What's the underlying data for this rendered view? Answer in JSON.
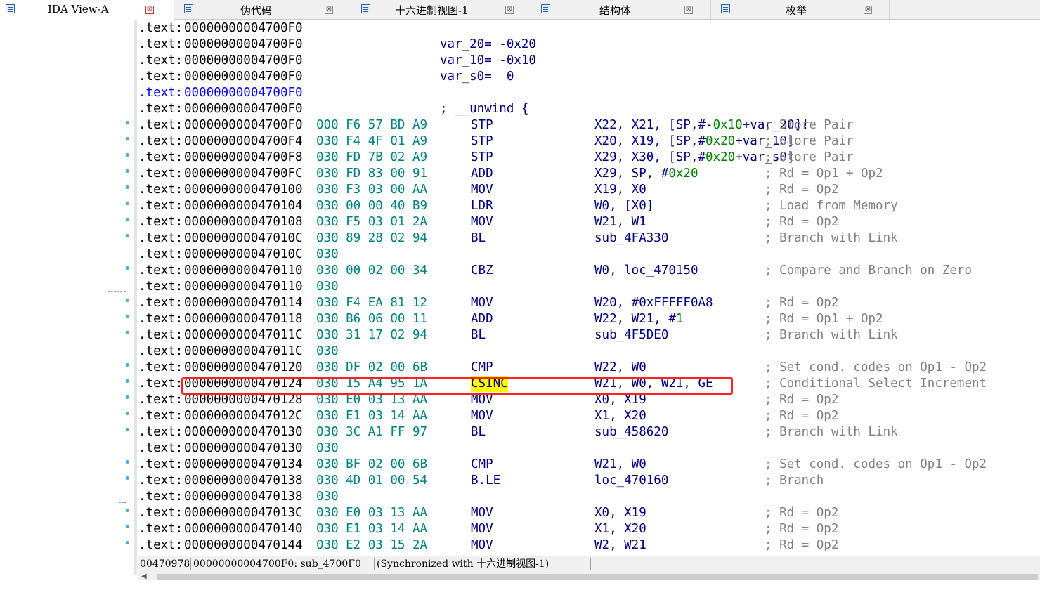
{
  "tabs": [
    {
      "label": "IDA View-A",
      "close": "⊠",
      "icon": "listing-icon",
      "active": true
    },
    {
      "label": "伪代码",
      "close": "⊠",
      "icon": "pseudocode-icon",
      "active": false
    },
    {
      "label": "十六进制视图-1",
      "close": "⊠",
      "icon": "hex-view-icon",
      "active": false
    },
    {
      "label": "结构体",
      "close": "⊠",
      "icon": "structures-icon",
      "active": false
    },
    {
      "label": "枚举",
      "close": "⊠",
      "icon": "enums-icon",
      "active": false
    }
  ],
  "listing": [
    {
      "seg": ".text:",
      "addr": "00000000004700F0",
      "bytes": "",
      "mn": "",
      "ops": [],
      "comment": "",
      "label": ""
    },
    {
      "seg": ".text:",
      "addr": "00000000004700F0",
      "bytes": "",
      "mn": "",
      "ops": [],
      "comment": "",
      "label": "var_20= -0x20"
    },
    {
      "seg": ".text:",
      "addr": "00000000004700F0",
      "bytes": "",
      "mn": "",
      "ops": [],
      "comment": "",
      "label": "var_10= -0x10"
    },
    {
      "seg": ".text:",
      "addr": "00000000004700F0",
      "bytes": "",
      "mn": "",
      "ops": [],
      "comment": "",
      "label": "var_s0=  0"
    },
    {
      "seg": ".text:",
      "addr": "00000000004700F0",
      "bytes": "",
      "mn": "",
      "ops": [],
      "comment": "",
      "label": "",
      "blue": true
    },
    {
      "seg": ".text:",
      "addr": "00000000004700F0",
      "bytes": "",
      "mn": "",
      "ops": [],
      "comment": "",
      "label": "; __unwind {"
    },
    {
      "seg": ".text:",
      "addr": "00000000004700F0",
      "bytes": "000 F6 57 BD A9",
      "mn": "STP",
      "ops": [
        "X22, X21, [SP,#-",
        "0x10",
        "+",
        "var_20",
        "]!"
      ],
      "comment": "; Store Pair"
    },
    {
      "seg": ".text:",
      "addr": "00000000004700F4",
      "bytes": "030 F4 4F 01 A9",
      "mn": "STP",
      "ops": [
        "X20, X19, [SP,#",
        "0x20",
        "+",
        "var_10",
        "]"
      ],
      "comment": "; Store Pair"
    },
    {
      "seg": ".text:",
      "addr": "00000000004700F8",
      "bytes": "030 FD 7B 02 A9",
      "mn": "STP",
      "ops": [
        "X29, X30, [SP,#",
        "0x20",
        "+",
        "var_s0",
        "]"
      ],
      "comment": "; Store Pair"
    },
    {
      "seg": ".text:",
      "addr": "00000000004700FC",
      "bytes": "030 FD 83 00 91",
      "mn": "ADD",
      "ops": [
        "X29, SP, #",
        "0x20"
      ],
      "comment": "; Rd = Op1 + Op2"
    },
    {
      "seg": ".text:",
      "addr": "0000000000470100",
      "bytes": "030 F3 03 00 AA",
      "mn": "MOV",
      "ops": [
        "X19, X0"
      ],
      "comment": "; Rd = Op2"
    },
    {
      "seg": ".text:",
      "addr": "0000000000470104",
      "bytes": "030 00 00 40 B9",
      "mn": "LDR",
      "ops": [
        "W0, [X0]"
      ],
      "comment": "; Load from Memory"
    },
    {
      "seg": ".text:",
      "addr": "0000000000470108",
      "bytes": "030 F5 03 01 2A",
      "mn": "MOV",
      "ops": [
        "W21, W1"
      ],
      "comment": "; Rd = Op2"
    },
    {
      "seg": ".text:",
      "addr": "000000000047010C",
      "bytes": "030 89 28 02 94",
      "mn": "BL",
      "ops": [
        "sub_4FA330"
      ],
      "comment": "; Branch with Link"
    },
    {
      "seg": ".text:",
      "addr": "000000000047010C",
      "bytes": "030",
      "mn": "",
      "ops": [],
      "comment": ""
    },
    {
      "seg": ".text:",
      "addr": "0000000000470110",
      "bytes": "030 00 02 00 34",
      "mn": "CBZ",
      "ops": [
        "W0, loc_470150"
      ],
      "comment": "; Compare and Branch on Zero"
    },
    {
      "seg": ".text:",
      "addr": "0000000000470110",
      "bytes": "030",
      "mn": "",
      "ops": [],
      "comment": ""
    },
    {
      "seg": ".text:",
      "addr": "0000000000470114",
      "bytes": "030 F4 EA 81 12",
      "mn": "MOV",
      "ops": [
        "W20, #0xFFFFF0A8"
      ],
      "comment": "; Rd = Op2"
    },
    {
      "seg": ".text:",
      "addr": "0000000000470118",
      "bytes": "030 B6 06 00 11",
      "mn": "ADD",
      "ops": [
        "W22, W21, #",
        "1"
      ],
      "comment": "; Rd = Op1 + Op2"
    },
    {
      "seg": ".text:",
      "addr": "000000000047011C",
      "bytes": "030 31 17 02 94",
      "mn": "BL",
      "ops": [
        "sub_4F5DE0"
      ],
      "comment": "; Branch with Link"
    },
    {
      "seg": ".text:",
      "addr": "000000000047011C",
      "bytes": "030",
      "mn": "",
      "ops": [],
      "comment": ""
    },
    {
      "seg": ".text:",
      "addr": "0000000000470120",
      "bytes": "030 DF 02 00 6B",
      "mn": "CMP",
      "ops": [
        "W22, W0"
      ],
      "comment": "; Set cond. codes on Op1 - Op2"
    },
    {
      "seg": ".text:",
      "addr": "0000000000470124",
      "bytes": "030 15 A4 95 1A",
      "mn": "CSINC",
      "ops": [
        "W21, W0, W21, GE"
      ],
      "comment": "; Conditional Select Increment",
      "highlight": true
    },
    {
      "seg": ".text:",
      "addr": "0000000000470128",
      "bytes": "030 E0 03 13 AA",
      "mn": "MOV",
      "ops": [
        "X0, X19"
      ],
      "comment": "; Rd = Op2"
    },
    {
      "seg": ".text:",
      "addr": "000000000047012C",
      "bytes": "030 E1 03 14 AA",
      "mn": "MOV",
      "ops": [
        "X1, X20"
      ],
      "comment": "; Rd = Op2"
    },
    {
      "seg": ".text:",
      "addr": "0000000000470130",
      "bytes": "030 3C A1 FF 97",
      "mn": "BL",
      "ops": [
        "sub_458620"
      ],
      "comment": "; Branch with Link"
    },
    {
      "seg": ".text:",
      "addr": "0000000000470130",
      "bytes": "030",
      "mn": "",
      "ops": [],
      "comment": ""
    },
    {
      "seg": ".text:",
      "addr": "0000000000470134",
      "bytes": "030 BF 02 00 6B",
      "mn": "CMP",
      "ops": [
        "W21, W0"
      ],
      "comment": "; Set cond. codes on Op1 - Op2"
    },
    {
      "seg": ".text:",
      "addr": "0000000000470138",
      "bytes": "030 4D 01 00 54",
      "mn": "B.LE",
      "ops": [
        "loc_470160"
      ],
      "comment": "; Branch"
    },
    {
      "seg": ".text:",
      "addr": "0000000000470138",
      "bytes": "030",
      "mn": "",
      "ops": [],
      "comment": ""
    },
    {
      "seg": ".text:",
      "addr": "000000000047013C",
      "bytes": "030 E0 03 13 AA",
      "mn": "MOV",
      "ops": [
        "X0, X19"
      ],
      "comment": "; Rd = Op2"
    },
    {
      "seg": ".text:",
      "addr": "0000000000470140",
      "bytes": "030 E1 03 14 AA",
      "mn": "MOV",
      "ops": [
        "X1, X20"
      ],
      "comment": "; Rd = Op2"
    },
    {
      "seg": ".text:",
      "addr": "0000000000470144",
      "bytes": "030 E2 03 15 2A",
      "mn": "MOV",
      "ops": [
        "W2, W21"
      ],
      "comment": "; Rd = Op2"
    }
  ],
  "status": {
    "offset": "00470978",
    "location": "00000000004700F0: sub_4700F0",
    "sync": "(Synchronized with 十六进制视图-1)"
  },
  "colors": {
    "address_blue": "#0000ff",
    "bytes_teal": "#008080",
    "mnemonic_navy": "#000080",
    "number_green": "#008000",
    "comment_gray": "#808080",
    "highlight_yellow": "#ffff00",
    "annotation_red": "#ff2222",
    "gutter_dot": "#49a9e3"
  }
}
